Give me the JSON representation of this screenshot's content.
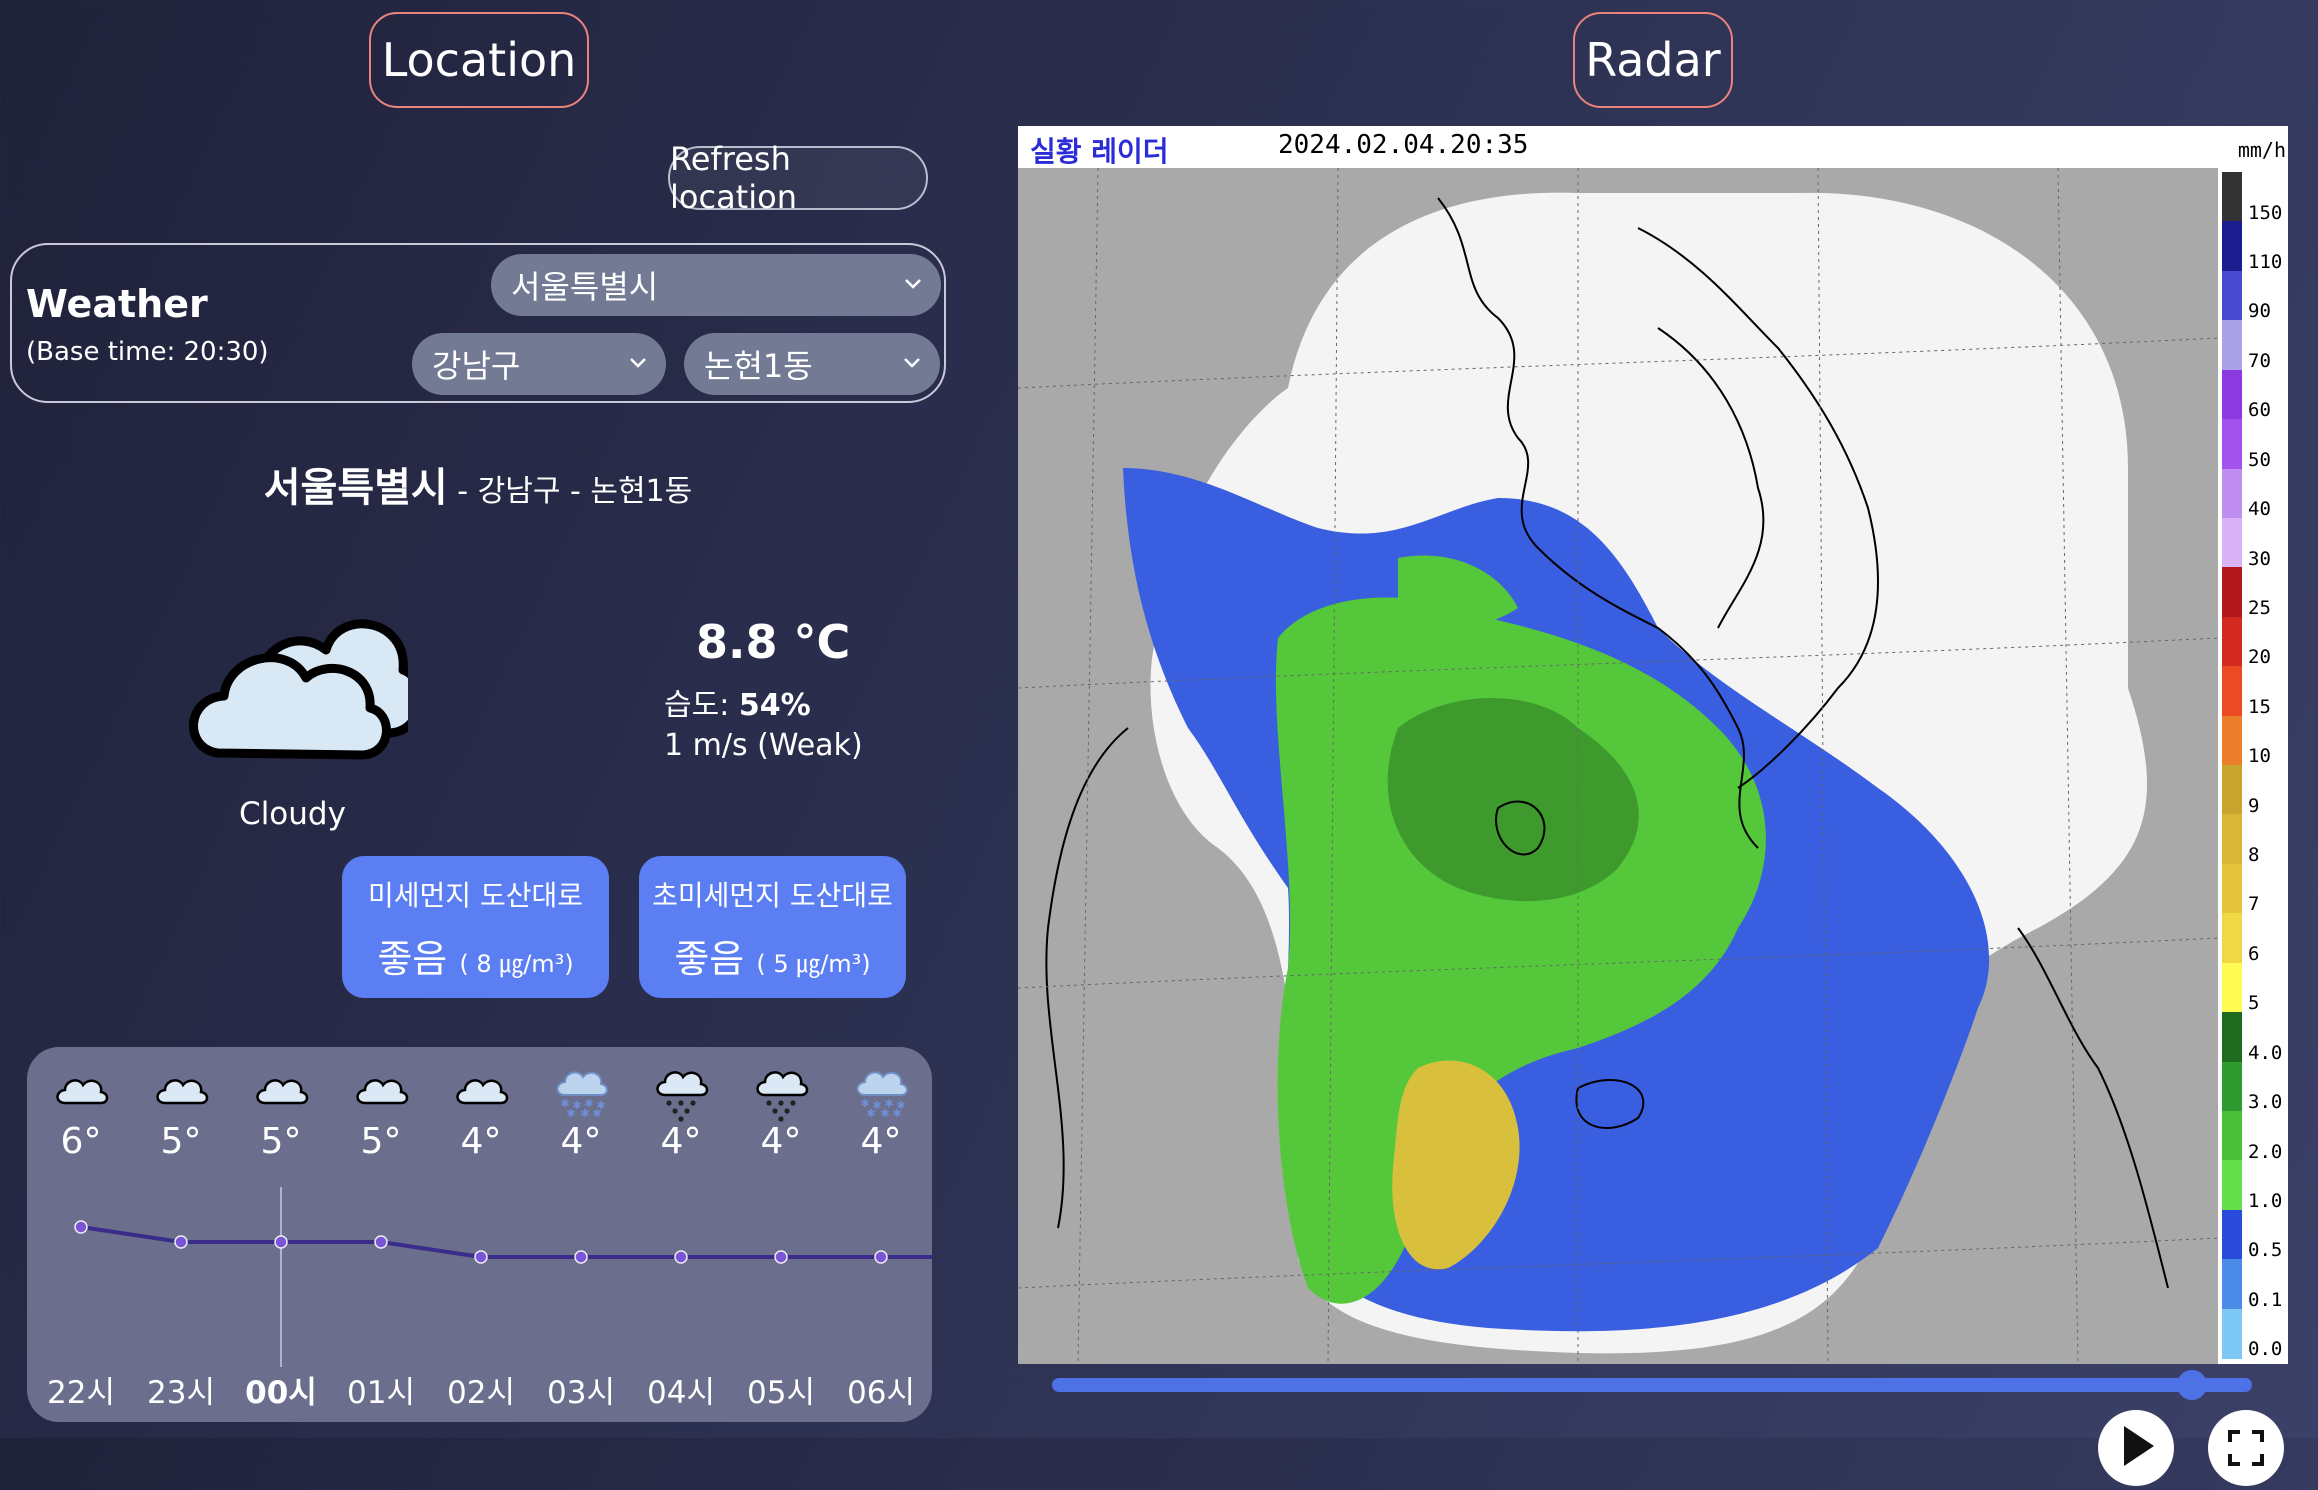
{
  "location_title": "Location",
  "radar_title": "Radar",
  "refresh_label": "Refresh location",
  "weather": {
    "label": "Weather",
    "base_time": "(Base time: 20:30)",
    "city_select": "서울특별시",
    "gu_select": "강남구",
    "dong_select": "논현1동"
  },
  "location_line": {
    "city": "서울특별시",
    "gu": "- 강남구",
    "dong": "- 논현1동"
  },
  "current": {
    "icon": "cloudy-icon",
    "condition": "Cloudy",
    "temperature": "8.8 °C",
    "humidity_label": "습도: ",
    "humidity_value": "54%",
    "wind": "1 m/s (Weak)"
  },
  "dust": {
    "pm10": {
      "label": "미세먼지 도산대로",
      "grade": "좋음",
      "value": "( 8 ㎍/m³)"
    },
    "pm25": {
      "label": "초미세먼지 도산대로",
      "grade": "좋음",
      "value": "( 5 ㎍/m³)"
    }
  },
  "forecast": {
    "hours": [
      {
        "hour": "22시",
        "temp": "6°",
        "t": 6,
        "icon": "cloud-icon",
        "current": false
      },
      {
        "hour": "23시",
        "temp": "5°",
        "t": 5,
        "icon": "cloud-icon",
        "current": false
      },
      {
        "hour": "00시",
        "temp": "5°",
        "t": 5,
        "icon": "cloud-icon",
        "current": true
      },
      {
        "hour": "01시",
        "temp": "5°",
        "t": 5,
        "icon": "cloud-icon",
        "current": false
      },
      {
        "hour": "02시",
        "temp": "4°",
        "t": 4,
        "icon": "cloud-icon",
        "current": false
      },
      {
        "hour": "03시",
        "temp": "4°",
        "t": 4,
        "icon": "snow-cloud-icon",
        "current": false
      },
      {
        "hour": "04시",
        "temp": "4°",
        "t": 4,
        "icon": "rain-snow-cloud-icon",
        "current": false
      },
      {
        "hour": "05시",
        "temp": "4°",
        "t": 4,
        "icon": "rain-snow-cloud-icon",
        "current": false
      },
      {
        "hour": "06시",
        "temp": "4°",
        "t": 4,
        "icon": "snow-cloud-icon",
        "current": false
      }
    ],
    "line_color": "#3a2c8a"
  },
  "radar": {
    "label": "실황 레이더",
    "timestamp": "2024.02.04.20:35",
    "unit": "mm/h",
    "legend": [
      {
        "label": "150",
        "color": "#333333"
      },
      {
        "label": "110",
        "color": "#1c1c8f"
      },
      {
        "label": "90",
        "color": "#4a4ad1"
      },
      {
        "label": "70",
        "color": "#a9a2e8"
      },
      {
        "label": "60",
        "color": "#8b3ae0"
      },
      {
        "label": "50",
        "color": "#a452ee"
      },
      {
        "label": "40",
        "color": "#c08ef2"
      },
      {
        "label": "30",
        "color": "#d9b3f5"
      },
      {
        "label": "25",
        "color": "#b1171b"
      },
      {
        "label": "20",
        "color": "#d4291f"
      },
      {
        "label": "15",
        "color": "#ea4a24"
      },
      {
        "label": "10",
        "color": "#ea7e2a"
      },
      {
        "label": "9",
        "color": "#c9a42f"
      },
      {
        "label": "8",
        "color": "#d8b637"
      },
      {
        "label": "7",
        "color": "#e4c43c"
      },
      {
        "label": "6",
        "color": "#f0d845"
      },
      {
        "label": "5",
        "color": "#fffb52"
      },
      {
        "label": "4.0",
        "color": "#1f6b1f"
      },
      {
        "label": "3.0",
        "color": "#2f9a2f"
      },
      {
        "label": "2.0",
        "color": "#4cbf3a"
      },
      {
        "label": "1.0",
        "color": "#66e04a"
      },
      {
        "label": "0.5",
        "color": "#2b4bdc"
      },
      {
        "label": "0.1",
        "color": "#4a8be8"
      },
      {
        "label": "0.0",
        "color": "#7ec8f5"
      }
    ],
    "timeline_progress": 0.95
  }
}
